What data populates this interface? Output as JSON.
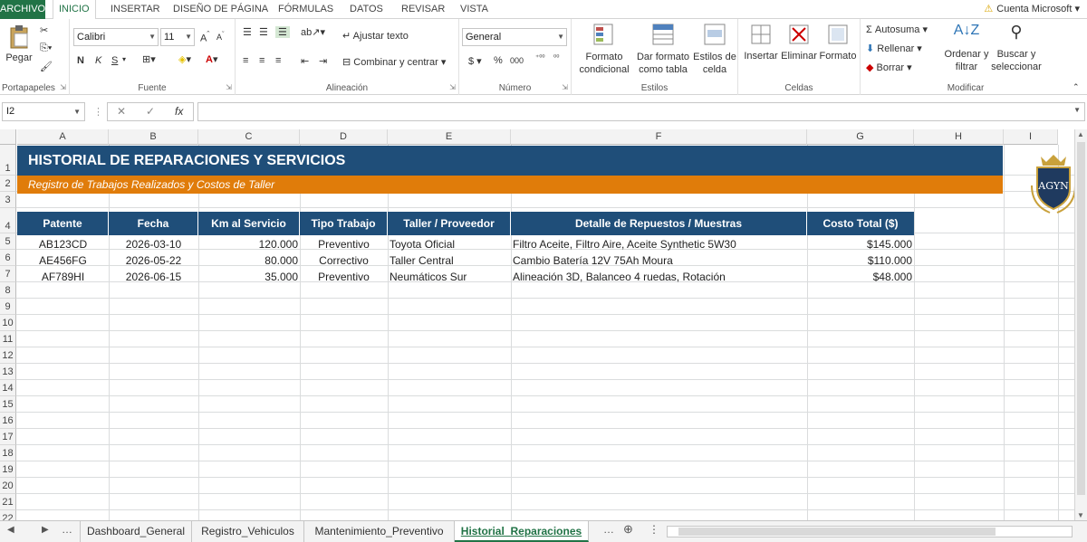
{
  "ribbon_tabs": [
    "ARCHIVO",
    "INICIO",
    "INSERTAR",
    "DISEÑO DE PÁGINA",
    "FÓRMULAS",
    "DATOS",
    "REVISAR",
    "VISTA"
  ],
  "account": "Cuenta Microsoft",
  "ribbon": {
    "clipboard": {
      "paste": "Pegar",
      "label": "Portapapeles"
    },
    "font": {
      "name": "Calibri",
      "size": "11",
      "bold": "N",
      "italic": "K",
      "underline": "S",
      "label": "Fuente"
    },
    "alignment": {
      "wrap": "Ajustar texto",
      "merge": "Combinar y centrar",
      "label": "Alineación"
    },
    "number": {
      "format": "General",
      "currency": "$",
      "percent": "%",
      "thousands": "000",
      "label": "Número"
    },
    "styles": {
      "conditional": "Formato condicional",
      "table": "Dar formato como tabla",
      "cell": "Estilos de celda",
      "label": "Estilos"
    },
    "cells": {
      "insert": "Insertar",
      "delete": "Eliminar",
      "format": "Formato",
      "label": "Celdas"
    },
    "editing": {
      "autosum": "Autosuma",
      "fill": "Rellenar",
      "clear": "Borrar",
      "sort": "Ordenar y filtrar",
      "find": "Buscar y seleccionar",
      "label": "Modificar"
    }
  },
  "formula_bar": {
    "name_box": "I2",
    "fx": "fx",
    "content": ""
  },
  "columns": [
    "A",
    "B",
    "C",
    "D",
    "E",
    "F",
    "G",
    "H",
    "I"
  ],
  "rows": [
    "1",
    "2",
    "3",
    "4",
    "5",
    "6",
    "7",
    "8",
    "9",
    "10",
    "11",
    "12",
    "13",
    "14",
    "15",
    "16",
    "17",
    "18",
    "19",
    "20",
    "21",
    "22"
  ],
  "sheet": {
    "title": "HISTORIAL DE REPARACIONES Y SERVICIOS",
    "subtitle": "Registro de Trabajos Realizados y Costos de Taller",
    "headers": [
      "Patente",
      "Fecha",
      "Km al Servicio",
      "Tipo Trabajo",
      "Taller / Proveedor",
      "Detalle de Repuestos / Muestras",
      "Costo Total ($)"
    ],
    "records": [
      [
        "AB123CD",
        "2026-03-10",
        "120.000",
        "Preventivo",
        "Toyota Oficial",
        "Filtro Aceite, Filtro Aire, Aceite Synthetic 5W30",
        "$145.000"
      ],
      [
        "AE456FG",
        "2026-05-22",
        "80.000",
        "Correctivo",
        "Taller Central",
        "Cambio Batería 12V 75Ah Moura",
        "$110.000"
      ],
      [
        "AF789HI",
        "2026-06-15",
        "35.000",
        "Preventivo",
        "Neumáticos Sur",
        "Alineación 3D, Balanceo 4 ruedas, Rotación",
        "$48.000"
      ]
    ],
    "logo_text": "AGYN"
  },
  "sheet_tabs": [
    "Dashboard_General",
    "Registro_Vehiculos",
    "Mantenimiento_Preventivo",
    "Historial_Reparaciones"
  ],
  "active_sheet": "Historial_Reparaciones",
  "colors": {
    "header_blue": "#1f4e79",
    "accent_orange": "#e07c0a",
    "excel_green": "#217346"
  }
}
